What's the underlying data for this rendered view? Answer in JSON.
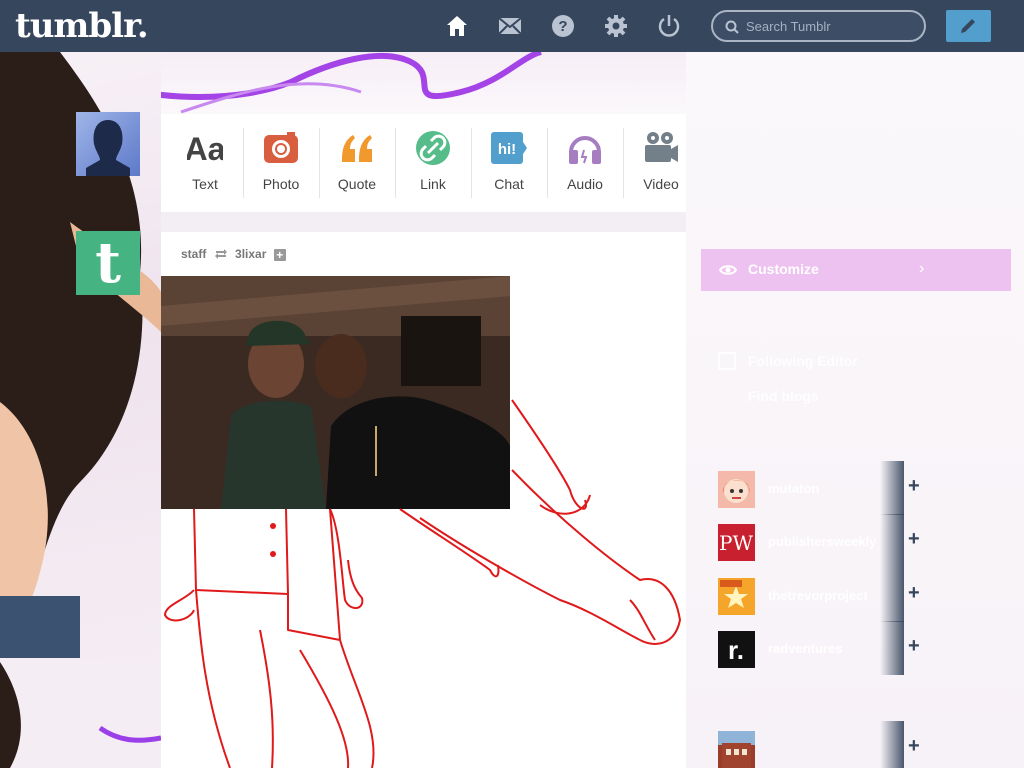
{
  "header": {
    "logo": "tumblr.",
    "search_placeholder": "Search Tumblr",
    "nav": [
      "home-icon",
      "mail-icon",
      "help-icon",
      "gear-icon",
      "power-icon"
    ]
  },
  "post_types": [
    {
      "label": "Text",
      "icon": "text-icon",
      "color": "#444444"
    },
    {
      "label": "Photo",
      "icon": "camera-icon",
      "color": "#d95e40"
    },
    {
      "label": "Quote",
      "icon": "quote-icon",
      "color": "#f2992e"
    },
    {
      "label": "Link",
      "icon": "link-icon",
      "color": "#56bc8a"
    },
    {
      "label": "Chat",
      "icon": "chat-icon",
      "color": "#529ecc"
    },
    {
      "label": "Audio",
      "icon": "headphones-icon",
      "color": "#a77dc2"
    },
    {
      "label": "Video",
      "icon": "video-camera-icon",
      "color": "#748089"
    }
  ],
  "post": {
    "author": "staff",
    "reblogged_from": "3lixar"
  },
  "sidebar": {
    "customize_label": "Customize",
    "faint_1": "Following Editor",
    "faint_2": "Find blogs",
    "recommended": [
      {
        "name": "mutaton",
        "avatar_color": "#f4b9a8"
      },
      {
        "name": "publishersweekly",
        "avatar_color": "#c8202f"
      },
      {
        "name": "thetrevorproject",
        "avatar_color": "#f6a52b"
      },
      {
        "name": "radventures",
        "avatar_color": "#111111"
      },
      {
        "name": "",
        "avatar_color": "#9b3b2a"
      }
    ]
  },
  "colors": {
    "header_bg": "#36465d",
    "compose_bg": "#529ecc",
    "accent_purple": "#9b3fe8",
    "doodle_red": "#e0191b"
  }
}
